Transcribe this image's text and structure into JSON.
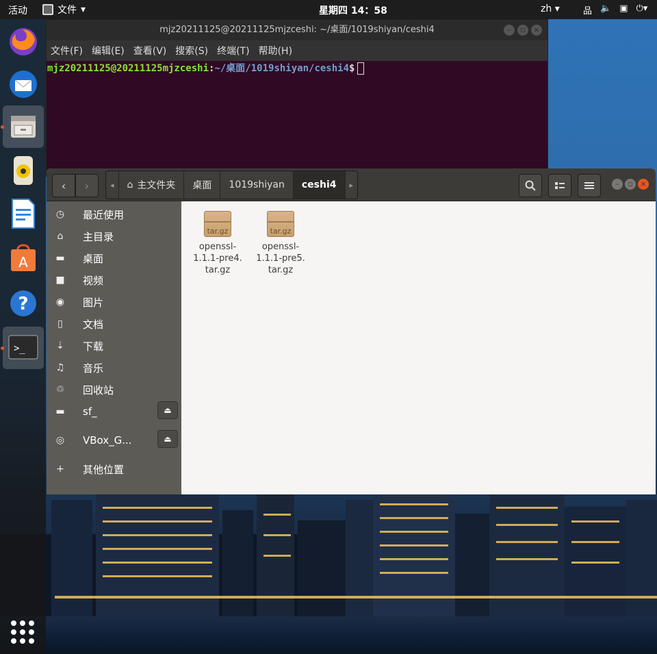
{
  "topbar": {
    "activities": "活动",
    "app_name": "文件",
    "clock": "星期四 14：58",
    "lang": "zh",
    "tray_icons": [
      "network-icon",
      "volume-icon",
      "clipboard-icon",
      "power-icon"
    ]
  },
  "dock": {
    "items": [
      {
        "name": "firefox"
      },
      {
        "name": "thunderbird"
      },
      {
        "name": "files",
        "active": true
      },
      {
        "name": "rhythmbox"
      },
      {
        "name": "libreoffice-writer"
      },
      {
        "name": "software-center"
      },
      {
        "name": "help"
      },
      {
        "name": "terminal",
        "active": true
      }
    ]
  },
  "terminal": {
    "title": "mjz20211125@20211125mjzceshi: ~/桌面/1019shiyan/ceshi4",
    "menu": [
      "文件(F)",
      "编辑(E)",
      "查看(V)",
      "搜索(S)",
      "终端(T)",
      "帮助(H)"
    ],
    "prompt_user": "mjz20211125@20211125mjzceshi",
    "prompt_sep": ":",
    "prompt_path": "~/桌面/1019shiyan/ceshi4",
    "prompt_symbol": "$"
  },
  "files": {
    "breadcrumb": {
      "home": "主文件夹",
      "desktop": "桌面",
      "folder": "1019shiyan",
      "current": "ceshi4"
    },
    "sidebar": [
      {
        "label": "最近使用",
        "icon": "clock-icon"
      },
      {
        "label": "主目录",
        "icon": "home-icon"
      },
      {
        "label": "桌面",
        "icon": "folder-icon"
      },
      {
        "label": "视频",
        "icon": "video-icon"
      },
      {
        "label": "图片",
        "icon": "camera-icon"
      },
      {
        "label": "文档",
        "icon": "document-icon"
      },
      {
        "label": "下载",
        "icon": "download-icon"
      },
      {
        "label": "音乐",
        "icon": "music-icon"
      },
      {
        "label": "回收站",
        "icon": "trash-icon"
      },
      {
        "label": "sf_",
        "icon": "drive-icon",
        "ejectable": true
      },
      {
        "label": "VBox_G...",
        "icon": "disc-icon",
        "ejectable": true
      },
      {
        "label": "其他位置",
        "icon": "plus-icon"
      }
    ],
    "items": [
      {
        "name_l1": "openssl-",
        "name_l2": "1.1.1-pre4.",
        "name_l3": "tar.gz",
        "badge": "tar.gz"
      },
      {
        "name_l1": "openssl-",
        "name_l2": "1.1.1-pre5.",
        "name_l3": "tar.gz",
        "badge": "tar.gz"
      }
    ]
  },
  "colors": {
    "accent": "#e95420",
    "terminal_bg": "#300a24",
    "prompt_user": "#8ae234",
    "prompt_path": "#729fcf",
    "sidebar_bg": "#5c5b56",
    "header_bg": "#3c3b37"
  }
}
